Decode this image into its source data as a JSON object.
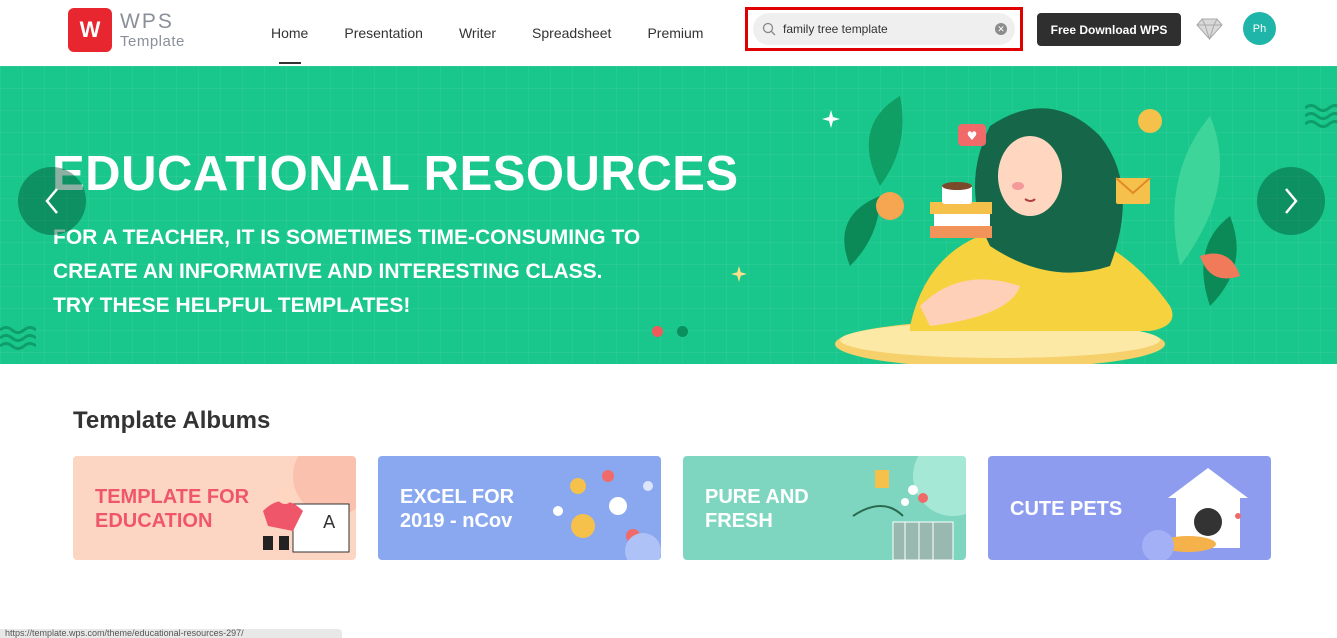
{
  "header": {
    "logo": {
      "mark": "W",
      "line1": "WPS",
      "line2": "Template"
    },
    "nav": [
      {
        "label": "Home",
        "active": true
      },
      {
        "label": "Presentation",
        "active": false
      },
      {
        "label": "Writer",
        "active": false
      },
      {
        "label": "Spreadsheet",
        "active": false
      },
      {
        "label": "Premium",
        "active": false
      }
    ],
    "search": {
      "value": "family tree template"
    },
    "download_label": "Free Download WPS",
    "avatar_initials": "Ph"
  },
  "banner": {
    "title": "EDUCATIONAL RESOURCES",
    "subtitle_lines": [
      "FOR A TEACHER, IT IS SOMETIMES TIME-CONSUMING TO",
      "CREATE AN INFORMATIVE AND INTERESTING CLASS.",
      "TRY THESE HELPFUL TEMPLATES!"
    ],
    "background_color": "#19c68b",
    "slide_count": 2,
    "active_slide": 1
  },
  "albums": {
    "title": "Template Albums",
    "items": [
      {
        "label_lines": [
          "TEMPLATE FOR",
          "EDUCATION"
        ],
        "bg": "#fcd6c2",
        "text_color": "#f0566a"
      },
      {
        "label_lines": [
          "EXCEL FOR",
          "2019 - nCov"
        ],
        "bg": "#8aa8f0",
        "text_color": "#ffffff"
      },
      {
        "label_lines": [
          "PURE AND",
          "FRESH"
        ],
        "bg": "#7fd6c0",
        "text_color": "#ffffff"
      },
      {
        "label_lines": [
          "CUTE PETS"
        ],
        "bg": "#8e9cf0",
        "text_color": "#ffffff"
      }
    ]
  },
  "status_bar": {
    "text": "https://template.wps.com/theme/educational-resources-297/"
  }
}
